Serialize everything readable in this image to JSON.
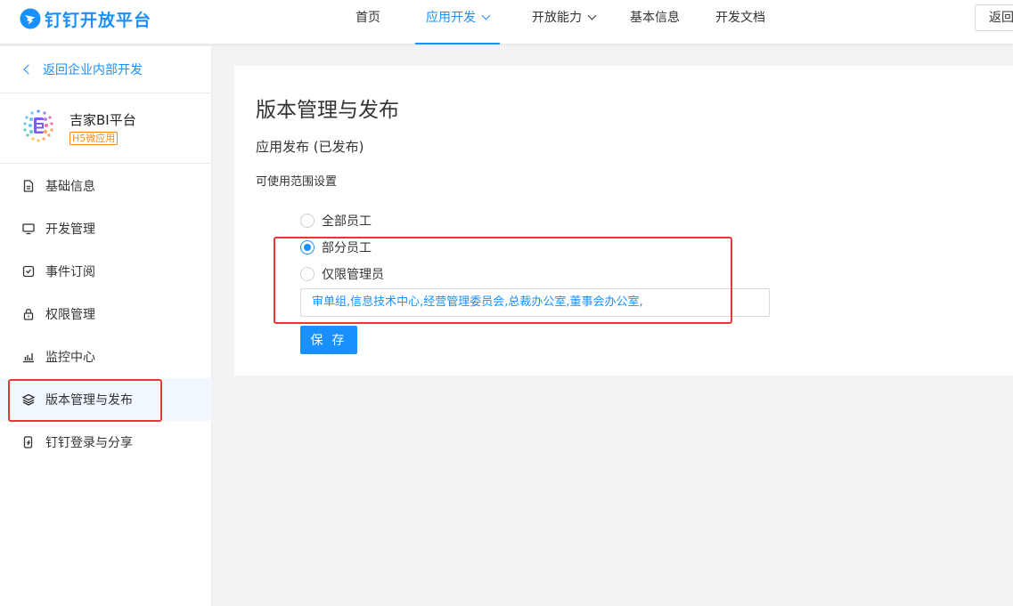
{
  "header": {
    "logo_text": "钉钉开放平台",
    "nav": [
      {
        "label": "首页"
      },
      {
        "label": "应用开发",
        "active": true,
        "dropdown": true
      },
      {
        "label": "开放能力",
        "dropdown": true
      },
      {
        "label": "基本信息"
      },
      {
        "label": "开发文档"
      }
    ],
    "back_button": "返回"
  },
  "sidebar": {
    "back_link": "返回企业内部开发",
    "app": {
      "name": "吉家BI平台",
      "tag": "H5微应用"
    },
    "items": [
      {
        "label": "基础信息",
        "icon": "document-icon"
      },
      {
        "label": "开发管理",
        "icon": "monitor-icon"
      },
      {
        "label": "事件订阅",
        "icon": "subscribe-icon"
      },
      {
        "label": "权限管理",
        "icon": "lock-icon"
      },
      {
        "label": "监控中心",
        "icon": "bar-chart-icon"
      },
      {
        "label": "版本管理与发布",
        "icon": "layers-icon",
        "active": true
      },
      {
        "label": "钉钉登录与分享",
        "icon": "phone-share-icon"
      }
    ]
  },
  "main": {
    "title": "版本管理与发布",
    "section": "应用发布 (已发布)",
    "range_label": "可使用范围设置",
    "options": [
      {
        "label": "全部员工",
        "checked": false
      },
      {
        "label": "部分员工",
        "checked": true
      },
      {
        "label": "仅限管理员",
        "checked": false
      }
    ],
    "scope_value": "审单组,信息技术中心,经营管理委员会,总裁办公室,董事会办公室,",
    "save": "保 存"
  },
  "colors": {
    "accent": "#1890ff",
    "annotation": "#e53935",
    "tag": "#fa8c16"
  }
}
